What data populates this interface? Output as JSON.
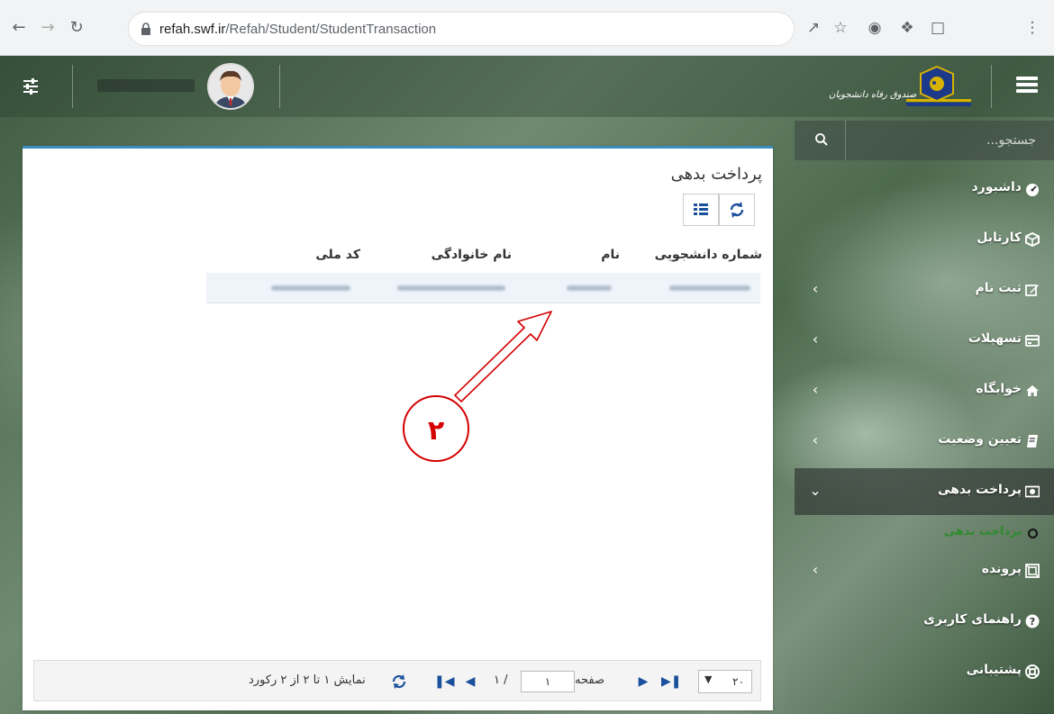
{
  "browser": {
    "url_host": "refah.swf.ir",
    "url_path": "/Refah/Student/StudentTransaction"
  },
  "header": {
    "logo_text": "صندوق رفاه دانشجویان"
  },
  "sidebar": {
    "search_placeholder": "جستجو...",
    "items": [
      {
        "label": "داشبورد",
        "icon": "dashboard-icon",
        "has_children": false
      },
      {
        "label": "کارتابل",
        "icon": "cube-icon",
        "has_children": false
      },
      {
        "label": "ثبت نام",
        "icon": "edit-icon",
        "has_children": true
      },
      {
        "label": "تسهیلات",
        "icon": "card-icon",
        "has_children": true
      },
      {
        "label": "خوابگاه",
        "icon": "home-icon",
        "has_children": true
      },
      {
        "label": "تعیین وضعیت",
        "icon": "book-icon",
        "has_children": true
      },
      {
        "label": "پرداخت بدهی",
        "icon": "money-icon",
        "has_children": true,
        "expanded": true
      },
      {
        "label": "پرونده",
        "icon": "folder-icon",
        "has_children": true
      },
      {
        "label": "راهنمای کاربری",
        "icon": "question-icon",
        "has_children": false
      },
      {
        "label": "پشتیبانی",
        "icon": "support-icon",
        "has_children": false
      }
    ],
    "sub_item": "پرداخت بدهی"
  },
  "panel": {
    "title": "پرداخت بدهی",
    "columns": [
      "شماره دانشجویی",
      "نام",
      "نام خانوادگی",
      "کد ملی"
    ],
    "pager": {
      "page_size": "۲۰",
      "page_label": "صفحه",
      "page_value": "۱",
      "page_total": "/ ۱",
      "summary": "نمایش ۱ تا ۲ از ۲ رکورد"
    }
  },
  "annotation": {
    "number": "۲",
    "color": "#d40000"
  }
}
